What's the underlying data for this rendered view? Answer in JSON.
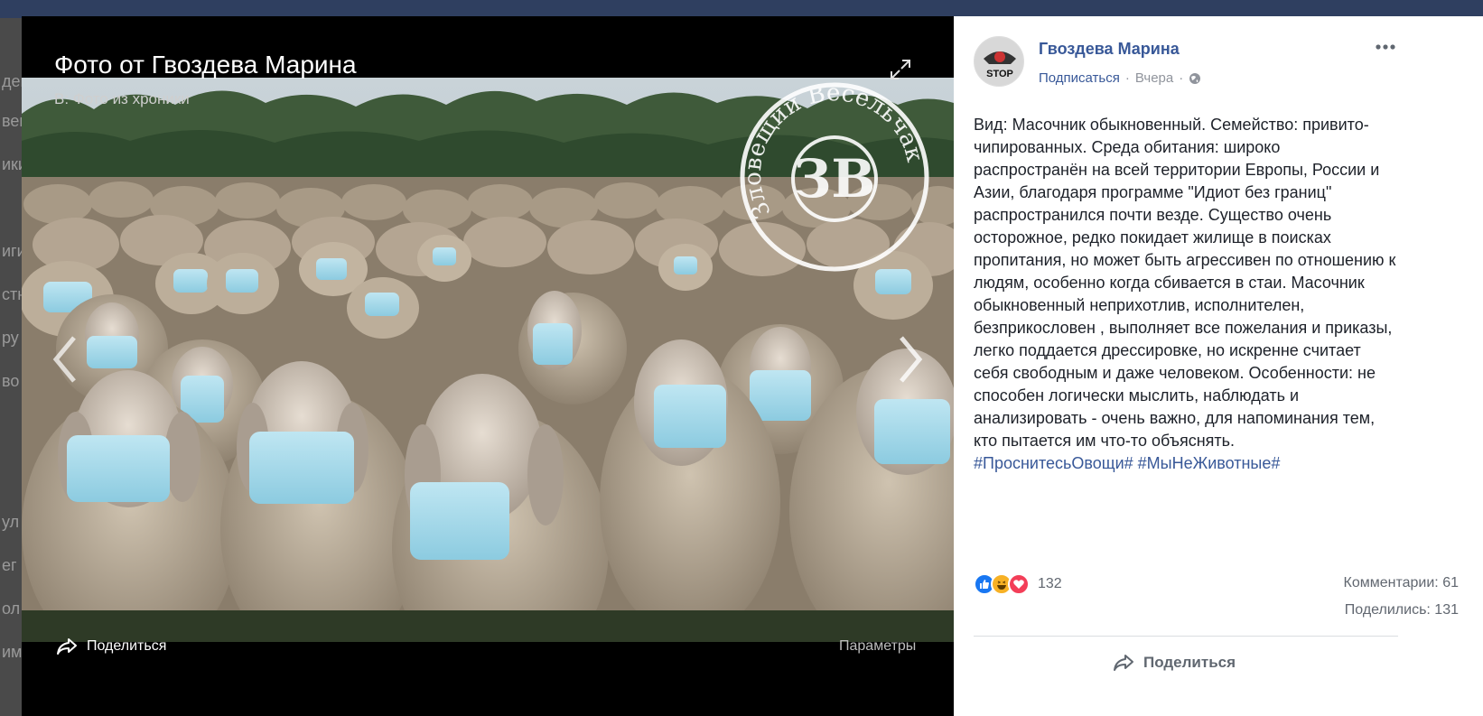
{
  "viewer": {
    "title": "Фото от Гвоздева Марина",
    "album": "В: Фото из хроники",
    "share_label": "Поделиться",
    "params_label": "Параметры"
  },
  "photo": {
    "watermark_text": "Зловещий Весельчак",
    "watermark_logo": "ЗВ"
  },
  "post": {
    "author": "Гвоздева Марина",
    "subscribe_label": "Подписаться",
    "separator": "·",
    "time": "Вчера",
    "text": "Вид: Масочник обыкновенный. Семейство: привито- чипированных. Среда обитания: широко распространён на всей территории Европы, России и Азии, благодаря программе \"Идиот без границ\" распространился почти везде. Существо очень осторожное, редко покидает жилище в поисках пропитания, но может быть агрессивен по отношению к людям, особенно когда сбивается в стаи. Масочник обыкновенный неприхотлив, исполнителен, безприкословен , выполняет все пожелания и приказы, легко поддается дрессировке, но искренне считает себя свободным и даже человеком. Особенности: не способен логически мыслить, наблюдать и анализировать - очень важно, для напоминания тем, кто пытается им что-то объяснять.",
    "hashtags": "#ПроснитесьОвощи# #МыНеЖивотные#",
    "reaction_count": "132",
    "comments": "Комментарии: 61",
    "shares": "Поделились: 131",
    "share_label": "Поделиться"
  },
  "avatar": {
    "label": "STOP"
  },
  "colors": {
    "link": "#385898",
    "like": "#1877f2",
    "haha": "#f7b125",
    "love": "#f33e58"
  }
}
